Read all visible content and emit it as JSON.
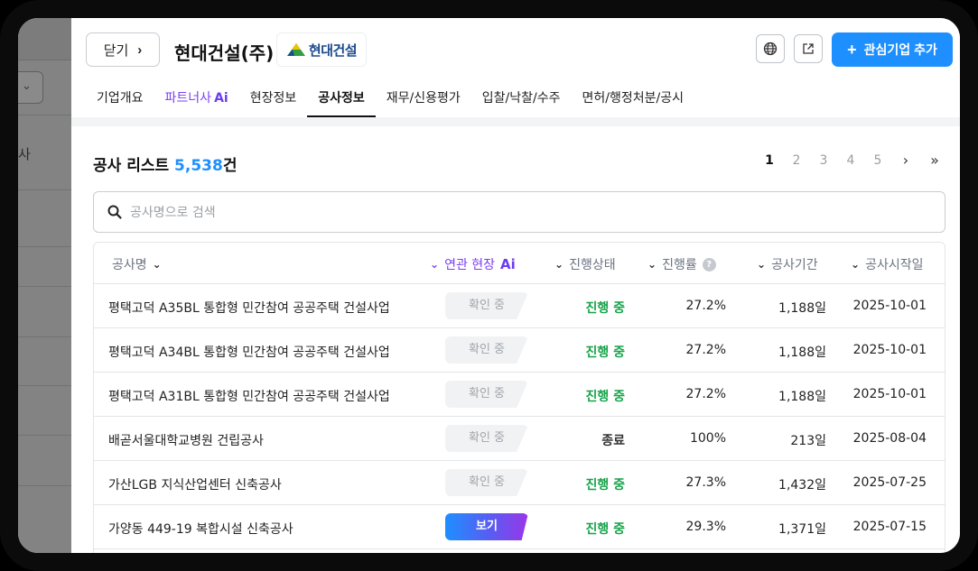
{
  "company": {
    "close_label": "닫기",
    "name": "현대건설(주)",
    "logo_text": "현대건설",
    "add_button": "관심기업 추가"
  },
  "tabs": [
    {
      "label": "기업개요"
    },
    {
      "label": "파트너사",
      "suffix": "Ai"
    },
    {
      "label": "현장정보"
    },
    {
      "label": "공사정보"
    },
    {
      "label": "재무/신용평가"
    },
    {
      "label": "입찰/낙찰/수주"
    },
    {
      "label": "면허/행정처분/공시"
    }
  ],
  "list": {
    "title": "공사 리스트",
    "count": "5,538",
    "count_unit": "건"
  },
  "pager": {
    "pages": [
      "1",
      "2",
      "3",
      "4",
      "5"
    ],
    "current": "1"
  },
  "search": {
    "placeholder": "공사명으로 검색"
  },
  "table": {
    "headers": {
      "name": "공사명",
      "related": "연관 현장",
      "related_ai": "Ai",
      "status": "진행상태",
      "rate": "진행률",
      "period": "공사기간",
      "start": "공사시작일"
    },
    "rows": [
      {
        "name": "평택고덕 A35BL 통합형 민간참여 공공주택 건설사업",
        "related": "확인 중",
        "status": "진행 중",
        "rate": "27.2%",
        "period": "1,188일",
        "start": "2025-10-01"
      },
      {
        "name": "평택고덕 A34BL 통합형 민간참여 공공주택 건설사업",
        "related": "확인 중",
        "status": "진행 중",
        "rate": "27.2%",
        "period": "1,188일",
        "start": "2025-10-01"
      },
      {
        "name": "평택고덕 A31BL 통합형 민간참여 공공주택 건설사업",
        "related": "확인 중",
        "status": "진행 중",
        "rate": "27.2%",
        "period": "1,188일",
        "start": "2025-10-01"
      },
      {
        "name": "배곧서울대학교병원 건립공사",
        "related": "확인 중",
        "status": "종료",
        "rate": "100%",
        "period": "213일",
        "start": "2025-08-04"
      },
      {
        "name": "가산LGB 지식산업센터 신축공사",
        "related": "확인 중",
        "status": "진행 중",
        "rate": "27.3%",
        "period": "1,432일",
        "start": "2025-07-25"
      },
      {
        "name": "가양동 449-19 복합시설 신축공사",
        "related": "보기",
        "status": "진행 중",
        "rate": "29.3%",
        "period": "1,371일",
        "start": "2025-07-15"
      }
    ]
  },
  "backdrop": {
    "partial_text": "사"
  },
  "colors": {
    "accent": "#1e8fff",
    "ai_purple": "#6c3cf0",
    "status_progress": "#17a34a"
  }
}
